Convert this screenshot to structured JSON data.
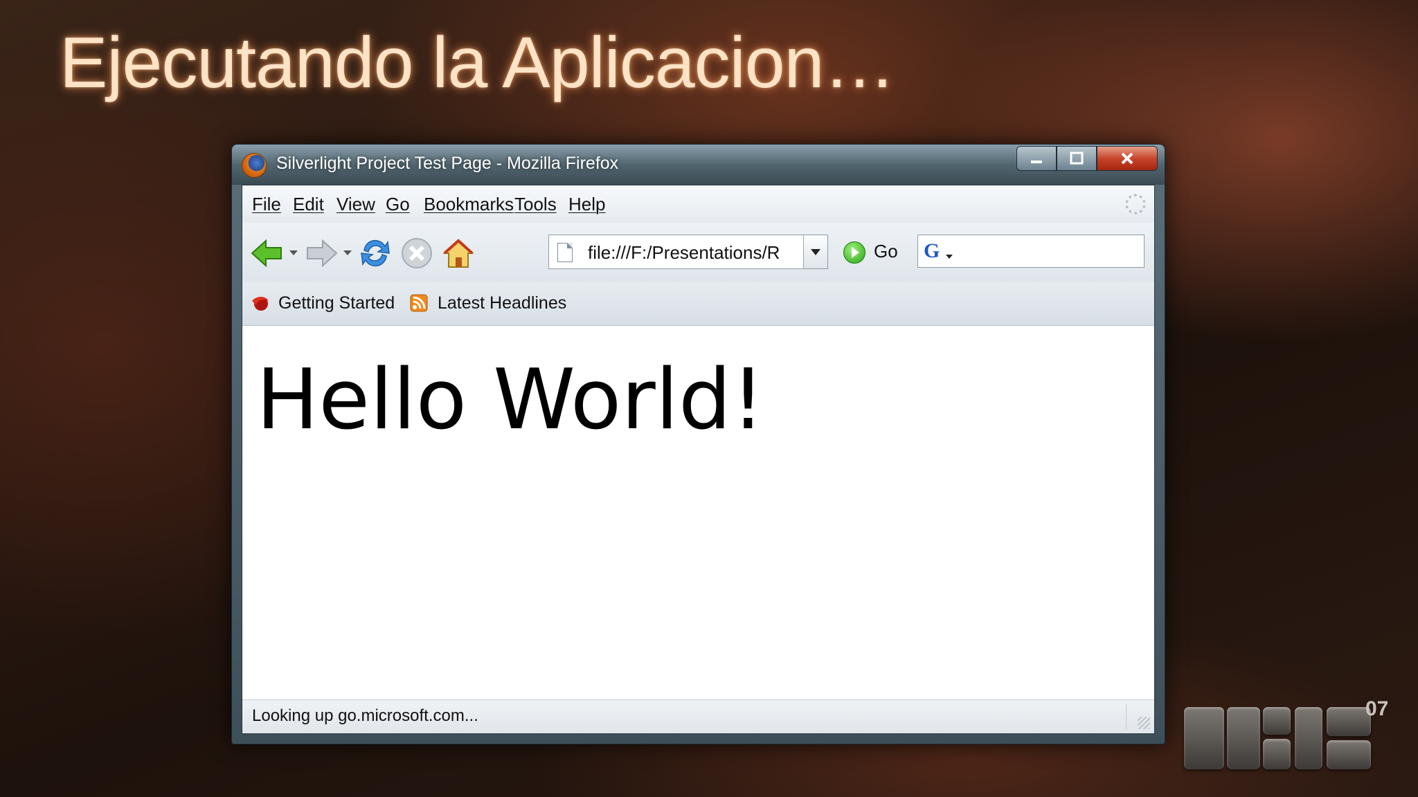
{
  "slide": {
    "title": "Ejecutando la Aplicacion…",
    "logo_text": "MIX",
    "logo_year": "07"
  },
  "window": {
    "title": "Silverlight Project Test Page - Mozilla Firefox",
    "controls": [
      "minimize",
      "maximize",
      "close"
    ]
  },
  "menubar": {
    "items": [
      "File",
      "Edit",
      "View",
      "Go",
      "Bookmarks",
      "Tools",
      "Help"
    ]
  },
  "navbar": {
    "url": "file:///F:/Presentations/R",
    "go_label": "Go",
    "search_engine_icon": "G",
    "search_value": ""
  },
  "bookmarks": {
    "items": [
      {
        "label": "Getting Started",
        "icon": "firefox-icon"
      },
      {
        "label": "Latest Headlines",
        "icon": "rss-feed-icon"
      }
    ]
  },
  "content": {
    "text": "Hello World!"
  },
  "statusbar": {
    "text": "Looking up go.microsoft.com..."
  },
  "colors": {
    "accent_glow": "#ffa05a",
    "close_button": "#c8452c",
    "window_chrome": "#52666f"
  }
}
